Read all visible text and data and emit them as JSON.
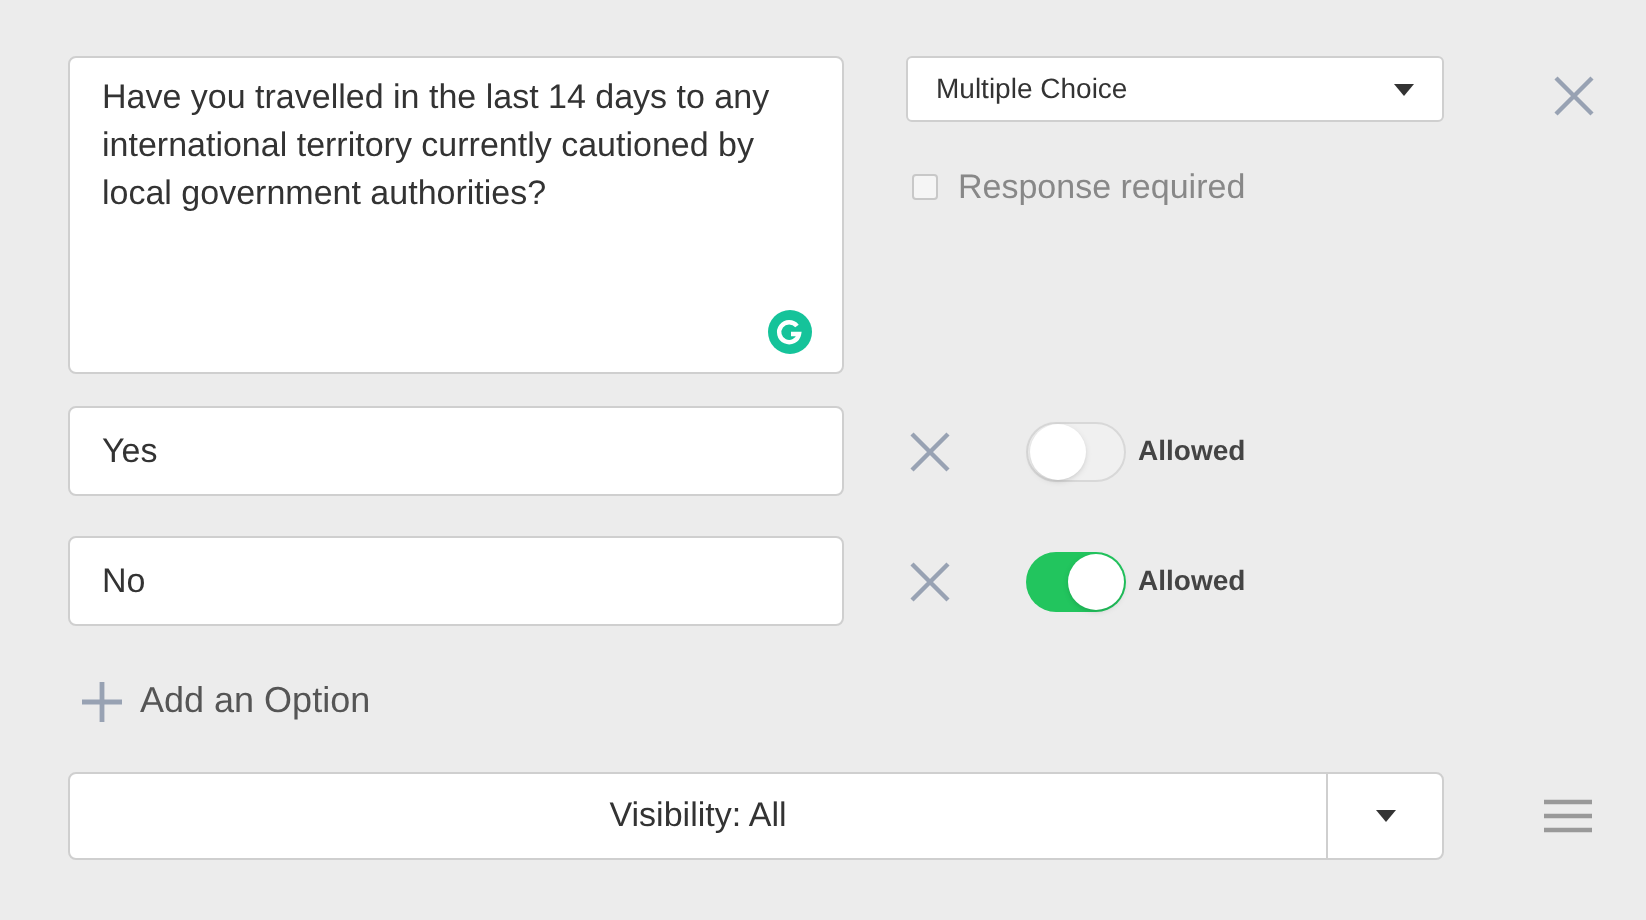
{
  "question": {
    "value": "Have you travelled in the last 14 days to any international territory currently cautioned by local government authorities?"
  },
  "type_select": {
    "value": "Multiple Choice"
  },
  "response_required": {
    "label": "Response required",
    "checked": false
  },
  "options": [
    {
      "value": "Yes",
      "toggle_label": "Allowed",
      "on": false
    },
    {
      "value": "No",
      "toggle_label": "Allowed",
      "on": true
    }
  ],
  "add_option": {
    "label": "Add an Option"
  },
  "visibility": {
    "label": "Visibility: All"
  }
}
